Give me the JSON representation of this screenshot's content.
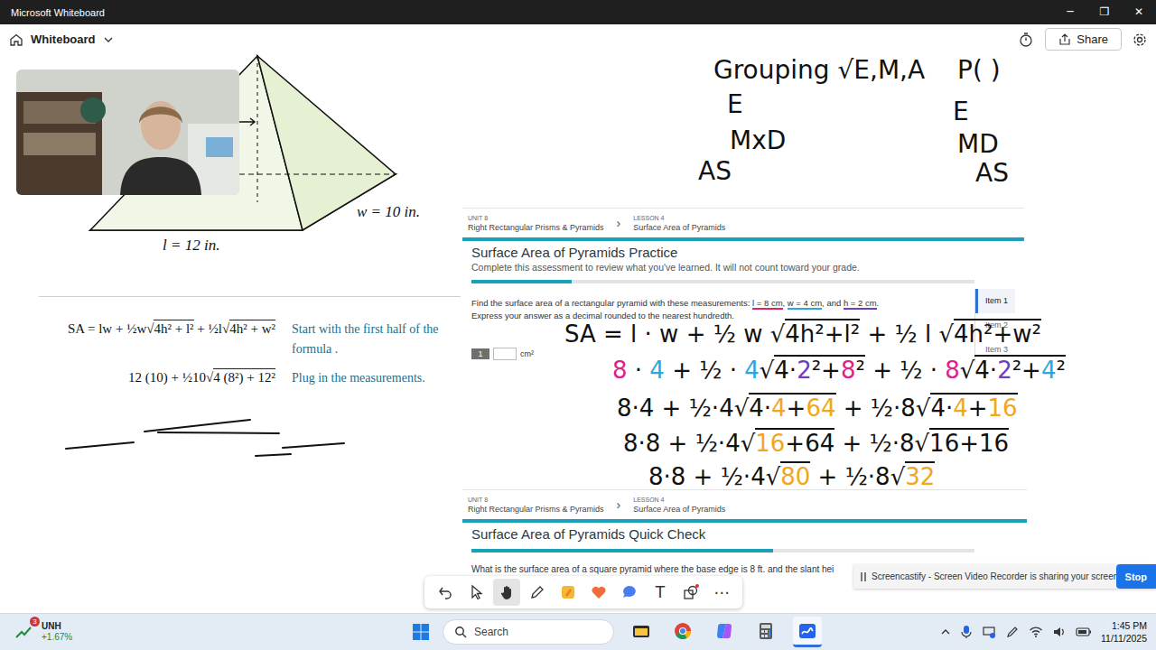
{
  "window": {
    "title": "Microsoft Whiteboard",
    "controls": [
      "─",
      "❐",
      "✕"
    ]
  },
  "app_bar": {
    "board_name": "Whiteboard",
    "share_label": "Share"
  },
  "pyramid": {
    "w_label": "w = 10 in.",
    "l_label": "l = 12 in."
  },
  "worked_example": {
    "rows": [
      {
        "math": [
          {
            "text": "SA = lw + ½w√",
            "over": false
          },
          {
            "text": "4h² + l²",
            "over": true
          },
          {
            "text": " + ½l√",
            "over": false
          },
          {
            "text": "4h² + w²",
            "over": true
          }
        ],
        "note": "Start with the first half of the formula ."
      },
      {
        "math": [
          {
            "text": "12 (10) + ½10√",
            "over": false
          },
          {
            "text": "4 (8²) + 12²",
            "over": true
          }
        ],
        "note": "Plug in the measurements."
      }
    ]
  },
  "notes": {
    "left": [
      "Grouping √E,M,A",
      "E",
      "MxD",
      "AS"
    ],
    "right": [
      "P( )",
      "E",
      "MD",
      "AS"
    ]
  },
  "practice": {
    "unit": "UNIT 8",
    "unit_name": "Right Rectangular Prisms & Pyramids",
    "separator": "›",
    "lesson": "LESSON 4",
    "lesson_name": "Surface Area of Pyramids",
    "title": "Surface Area of Pyramids Practice",
    "subtitle": "Complete this assessment to review what you've learned. It will not count toward your grade.",
    "progress": {
      "level": 0.2
    },
    "question": [
      {
        "text": "Find the surface area of a rectangular pyramid with these measurements: "
      },
      {
        "text": "l = 8 cm",
        "underline": "#e0245e"
      },
      {
        "text": ", "
      },
      {
        "text": "w = 4 cm",
        "underline": "#29a8e0"
      },
      {
        "text": ", and "
      },
      {
        "text": "h = 2 cm",
        "underline": "#6a3fc1"
      },
      {
        "text": "."
      }
    ],
    "instruction": "Express your answer as a decimal rounded to the nearest hundredth.",
    "answer": {
      "number": "1",
      "value": "",
      "unit": "cm²"
    },
    "items": [
      {
        "label": "Item 1",
        "selected": true
      },
      {
        "label": "Item 2",
        "selected": false
      },
      {
        "label": "Item 3",
        "selected": false
      }
    ]
  },
  "handwriting": [
    [
      {
        "text": "SA = l · w + ½ w √",
        "color": "#111111",
        "over": false
      },
      {
        "text": "4h²+l²",
        "color": "#111111",
        "over": true
      },
      {
        "text": " + ½ l √",
        "color": "#111111",
        "over": false
      },
      {
        "text": "4h²+w²",
        "color": "#111111",
        "over": true
      }
    ],
    [
      {
        "text": "8",
        "color": "#e0218a",
        "over": false
      },
      {
        "text": " · ",
        "color": "#111111",
        "over": false
      },
      {
        "text": "4",
        "color": "#29a8e0",
        "over": false
      },
      {
        "text": " + ½ · ",
        "color": "#111111",
        "over": false
      },
      {
        "text": "4",
        "color": "#29a8e0",
        "over": false
      },
      {
        "text": "√",
        "color": "#111111",
        "over": false
      },
      {
        "text": "4·",
        "color": "#111111",
        "over": true
      },
      {
        "text": "2",
        "color": "#6a3fc1",
        "over": true
      },
      {
        "text": "²+",
        "color": "#111111",
        "over": true
      },
      {
        "text": "8",
        "color": "#e0218a",
        "over": true
      },
      {
        "text": "²",
        "color": "#111111",
        "over": true
      },
      {
        "text": " + ½ · ",
        "color": "#111111",
        "over": false
      },
      {
        "text": "8",
        "color": "#e0218a",
        "over": false
      },
      {
        "text": "√",
        "color": "#111111",
        "over": false
      },
      {
        "text": "4·",
        "color": "#111111",
        "over": true
      },
      {
        "text": "2",
        "color": "#6a3fc1",
        "over": true
      },
      {
        "text": "²+",
        "color": "#111111",
        "over": true
      },
      {
        "text": "4",
        "color": "#29a8e0",
        "over": true
      },
      {
        "text": "²",
        "color": "#111111",
        "over": true
      }
    ],
    [
      {
        "text": "8·4 + ½·4√",
        "color": "#111111",
        "over": false
      },
      {
        "text": "4·",
        "color": "#111111",
        "over": true
      },
      {
        "text": "4",
        "color": "#f2a51f",
        "over": true
      },
      {
        "text": "+",
        "color": "#111111",
        "over": true
      },
      {
        "text": "64",
        "color": "#f2a51f",
        "over": true
      },
      {
        "text": " + ½·8√",
        "color": "#111111",
        "over": false
      },
      {
        "text": "4·",
        "color": "#111111",
        "over": true
      },
      {
        "text": "4",
        "color": "#f2a51f",
        "over": true
      },
      {
        "text": "+",
        "color": "#111111",
        "over": true
      },
      {
        "text": "16",
        "color": "#f2a51f",
        "over": true
      }
    ],
    [
      {
        "text": "8·8 + ½·4√",
        "color": "#111111",
        "over": false
      },
      {
        "text": "16",
        "color": "#f2a51f",
        "over": true
      },
      {
        "text": "+64",
        "color": "#111111",
        "over": true
      },
      {
        "text": " + ½·8√",
        "color": "#111111",
        "over": false
      },
      {
        "text": "16+16",
        "color": "#111111",
        "over": true
      }
    ],
    [
      {
        "text": "8·8 + ½·4√",
        "color": "#111111",
        "over": false
      },
      {
        "text": "80",
        "color": "#f2a51f",
        "over": true
      },
      {
        "text": " + ½·8√",
        "color": "#111111",
        "over": false
      },
      {
        "text": "32",
        "color": "#f2a51f",
        "over": true
      }
    ]
  ],
  "quick_check": {
    "unit": "UNIT 8",
    "unit_name": "Right Rectangular Prisms & Pyramids",
    "separator": "›",
    "lesson": "LESSON 4",
    "lesson_name": "Surface Area of Pyramids",
    "title": "Surface Area of Pyramids Quick Check",
    "progress": {
      "level": 0.6
    },
    "question": "What is the surface area of a square pyramid where the base edge is 8 ft. and the slant hei"
  },
  "toolbar": [
    {
      "kind": "undo",
      "selected": false
    },
    {
      "kind": "select",
      "selected": false
    },
    {
      "kind": "hand",
      "selected": true
    },
    {
      "kind": "pen",
      "selected": false
    },
    {
      "kind": "highlighter",
      "selected": false
    },
    {
      "kind": "heart",
      "selected": false
    },
    {
      "kind": "comment",
      "selected": false
    },
    {
      "kind": "text",
      "selected": false,
      "label": "T"
    },
    {
      "kind": "shapes",
      "selected": false
    },
    {
      "kind": "more",
      "selected": false,
      "label": "⋯"
    }
  ],
  "screencastify": {
    "message": "Screencastify - Screen Video Recorder is sharing your screen.",
    "button": "Stop"
  },
  "taskbar": {
    "widget": {
      "badge": "3",
      "name": "UNH",
      "change": "+1.67%"
    },
    "search_placeholder": "Search",
    "apps": [
      {
        "kind": "explorer",
        "active": false
      },
      {
        "kind": "chrome",
        "active": false
      },
      {
        "kind": "copilot",
        "active": false
      },
      {
        "kind": "calculator",
        "active": false
      },
      {
        "kind": "whiteboard",
        "active": true
      }
    ],
    "time": "1:45 PM",
    "date": "11/11/2025"
  }
}
